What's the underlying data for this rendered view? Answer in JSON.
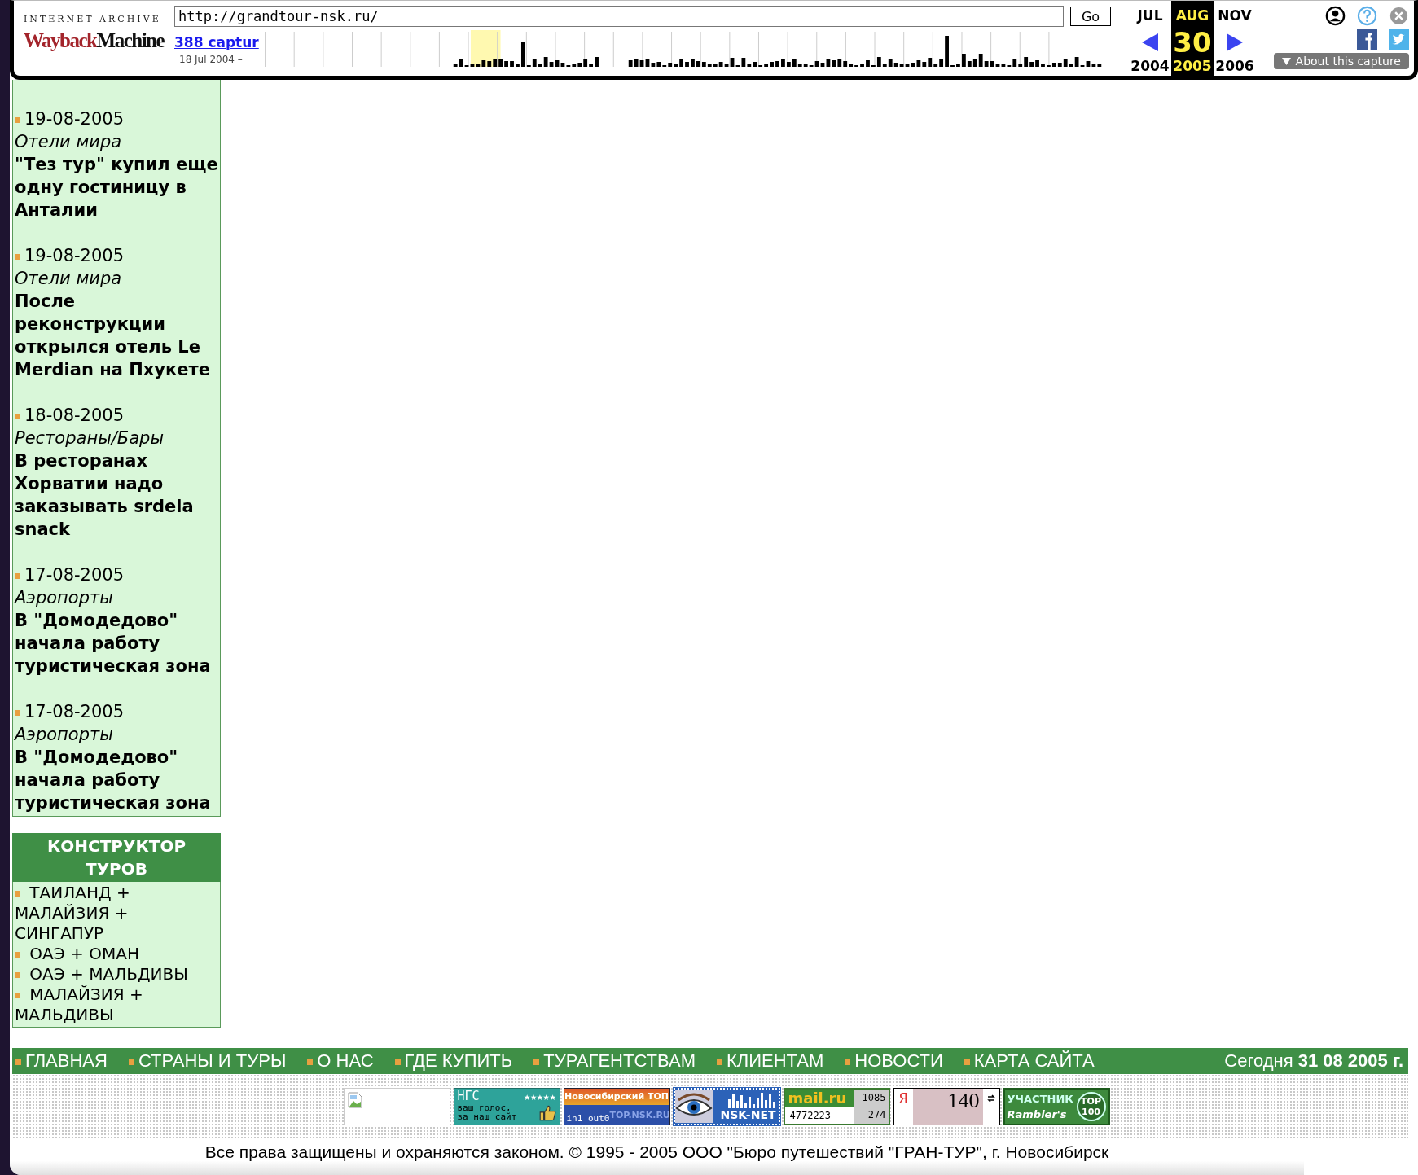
{
  "wayback": {
    "brand_top": "INTERNET ARCHIVE",
    "logo_left": "Wayback",
    "logo_right": "Machine",
    "url": "http://grandtour-nsk.ru/",
    "go": "Go",
    "captures_link": "388 captur",
    "date_range": "18 Jul 2004 –",
    "months": [
      {
        "month": "JUL",
        "year": "2004",
        "selected": false
      },
      {
        "month": "AUG",
        "day": "30",
        "year": "2005",
        "selected": true
      },
      {
        "month": "NOV",
        "year": "2006",
        "selected": false
      }
    ],
    "about_button": "About this capture"
  },
  "news": [
    {
      "date": "19-08-2005",
      "category": "Отели мира",
      "title": "\"Тез тур\" купил еще одну гостиницу в Анталии"
    },
    {
      "date": "19-08-2005",
      "category": "Отели мира",
      "title": "После реконструкции открылся отель Le Merdian на Пхукете"
    },
    {
      "date": "18-08-2005",
      "category": "Рестораны/Бары",
      "title": "В ресторанах Хорватии надо заказывать srdela snack"
    },
    {
      "date": "17-08-2005",
      "category": "Аэропорты",
      "title": "В \"Домодедово\" начала работу туристическая зона"
    },
    {
      "date": "17-08-2005",
      "category": "Аэропорты",
      "title": "В \"Домодедово\" начала работу туристическая зона"
    }
  ],
  "constructor": {
    "title": "КОНСТРУКТОР ТУРОВ",
    "items": [
      "ТАИЛАНД + МАЛАЙЗИЯ + СИНГАПУР",
      "ОАЭ + ОМАН",
      "ОАЭ + МАЛЬДИВЫ",
      "МАЛАЙЗИЯ + МАЛЬДИВЫ"
    ]
  },
  "nav": {
    "items": [
      "ГЛАВНАЯ",
      "СТРАНЫ И ТУРЫ",
      "О НАС",
      "ГДЕ КУПИТЬ",
      "ТУРАГЕНТСТВАМ",
      "КЛИЕНТАМ",
      "НОВОСТИ",
      "КАРТА САЙТА"
    ],
    "today": "Сегодня **31 08 2005 г.**"
  },
  "counters": [
    {
      "kind": "broken"
    },
    {
      "kind": "ngs",
      "lines": [
        "НГС",
        "★★★★★",
        "ваш голос,",
        "за наш сайт"
      ]
    },
    {
      "kind": "topnsk",
      "lines": [
        "Новосибирский ТОП",
        "in1 out0",
        "TOP.NSK.RU"
      ]
    },
    {
      "kind": "nsknet",
      "lines": [
        "NSK-NET"
      ]
    },
    {
      "kind": "mail",
      "lines": [
        "mail.ru",
        "1085",
        "4772223",
        "274"
      ]
    },
    {
      "kind": "yandex",
      "lines": [
        "Я",
        "140"
      ]
    },
    {
      "kind": "rambler",
      "lines": [
        "УЧАСТНИК",
        "Rambler's",
        "TOP",
        "100"
      ]
    }
  ],
  "footer": "Все права защищены и охраняются законом. © 1995 - 2005 ООО \"Бюро путешествий \"ГРАН-ТУР\", г. Новосибирск"
}
